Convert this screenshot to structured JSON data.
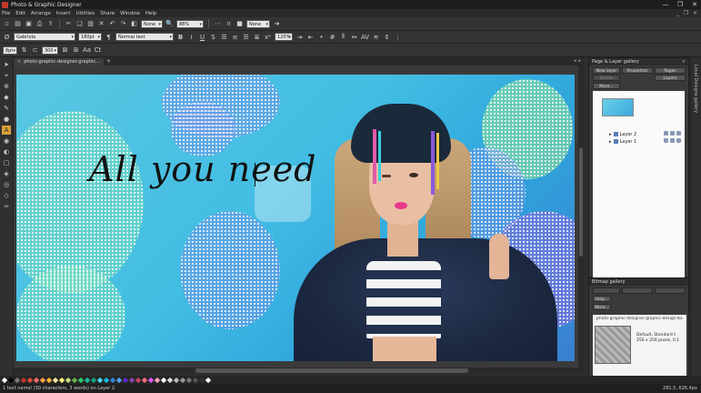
{
  "window": {
    "title": "Photo & Graphic Designer",
    "minimize": "—",
    "maximize": "❐",
    "close": "✕"
  },
  "menu": [
    "File",
    "Edit",
    "Arrange",
    "Insert",
    "Utilities",
    "Share",
    "Window",
    "Help"
  ],
  "toolbar1": {
    "zoom_select": "None",
    "zoom_percent": "88%",
    "quality_select": "None"
  },
  "toolbar2": {
    "font_name": "Gabriola",
    "font_size": "180pt",
    "text_style": "Normal text",
    "bold": "B",
    "italic": "I",
    "underline": "U",
    "strike": "S",
    "line_spacing": "120%"
  },
  "toolbar3": {
    "width_label": "8pt",
    "height_value": "300",
    "aa_label": "Aa",
    "ct_label": "Ct"
  },
  "document_tab": {
    "label": "photo-graphic-designer-graphic...",
    "close": "×",
    "new": "+"
  },
  "canvas": {
    "headline": "All you need"
  },
  "page_layer_gallery": {
    "title": "Page & Layer gallery",
    "buttons": {
      "new_layer": "New layer",
      "properties": "Properties",
      "pages": "Pages",
      "delete": "Delete",
      "layers": "Layers",
      "more": "More..."
    },
    "layers": [
      {
        "name": "Layer 2"
      },
      {
        "name": "Layer 1"
      }
    ]
  },
  "bitmap_gallery": {
    "title": "Bitmap gallery",
    "buttons": {
      "help": "Help...",
      "more": "More..."
    },
    "item_title": "photo-graphic-designer-graphic-design-back",
    "item_info_line1": "Default, Standard t",
    "item_info_line2": "256 x 256 pixels, 0.1"
  },
  "right_strip": {
    "label": "Local Designs gallery"
  },
  "palette": {
    "colors": [
      "#ffffff",
      "#000000",
      "#7a7a7a",
      "#c0392b",
      "#e74c3c",
      "#ff6b6b",
      "#ff9f43",
      "#f7b733",
      "#f9e79f",
      "#fff176",
      "#c5e17a",
      "#6ab04c",
      "#2ecc71",
      "#1abc9c",
      "#16a085",
      "#48dbfb",
      "#0abde3",
      "#2e86de",
      "#54a0ff",
      "#5f27cd",
      "#8e44ad",
      "#c44569",
      "#ff6b81",
      "#e056fd",
      "#f8a5c2",
      "#ffffff",
      "#dddddd",
      "#bbbbbb",
      "#999999",
      "#777777",
      "#555555",
      "#333333",
      "#ffffff"
    ]
  },
  "status": {
    "message": "1 text name/ (30 characters, 3 words) on Layer 2.",
    "coords": "281.5, 626.4px"
  }
}
